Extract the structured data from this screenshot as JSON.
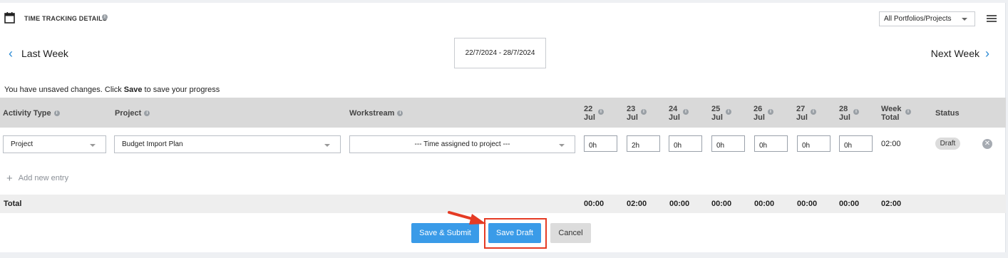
{
  "header": {
    "title": "TIME TRACKING DETAILS",
    "portfolio_select": "All Portfolios/Projects"
  },
  "nav": {
    "prev": "Last Week",
    "next": "Next Week",
    "date_range": "22/7/2024 - 28/7/2024"
  },
  "notice": {
    "prefix": "You have unsaved changes. Click ",
    "bold": "Save",
    "suffix": " to save your progress"
  },
  "columns": {
    "activity_type": "Activity Type",
    "project": "Project",
    "workstream": "Workstream",
    "days": [
      {
        "d": "22",
        "m": "Jul"
      },
      {
        "d": "23",
        "m": "Jul"
      },
      {
        "d": "24",
        "m": "Jul"
      },
      {
        "d": "25",
        "m": "Jul"
      },
      {
        "d": "26",
        "m": "Jul"
      },
      {
        "d": "27",
        "m": "Jul"
      },
      {
        "d": "28",
        "m": "Jul"
      }
    ],
    "week_total_1": "Week",
    "week_total_2": "Total",
    "status": "Status"
  },
  "entry": {
    "activity_type": "Project",
    "project": "Budget Import Plan",
    "workstream": "--- Time assigned to project ---",
    "hours": [
      "0h",
      "2h",
      "0h",
      "0h",
      "0h",
      "0h",
      "0h"
    ],
    "week_total": "02:00",
    "status": "Draft"
  },
  "add_entry": "Add new entry",
  "totals": {
    "label": "Total",
    "days": [
      "00:00",
      "02:00",
      "00:00",
      "00:00",
      "00:00",
      "00:00",
      "00:00"
    ],
    "week": "02:00"
  },
  "buttons": {
    "save_submit": "Save & Submit",
    "save_draft": "Save Draft",
    "cancel": "Cancel"
  },
  "colors": {
    "accent": "#3a9be8",
    "annotation": "#e53b24"
  }
}
